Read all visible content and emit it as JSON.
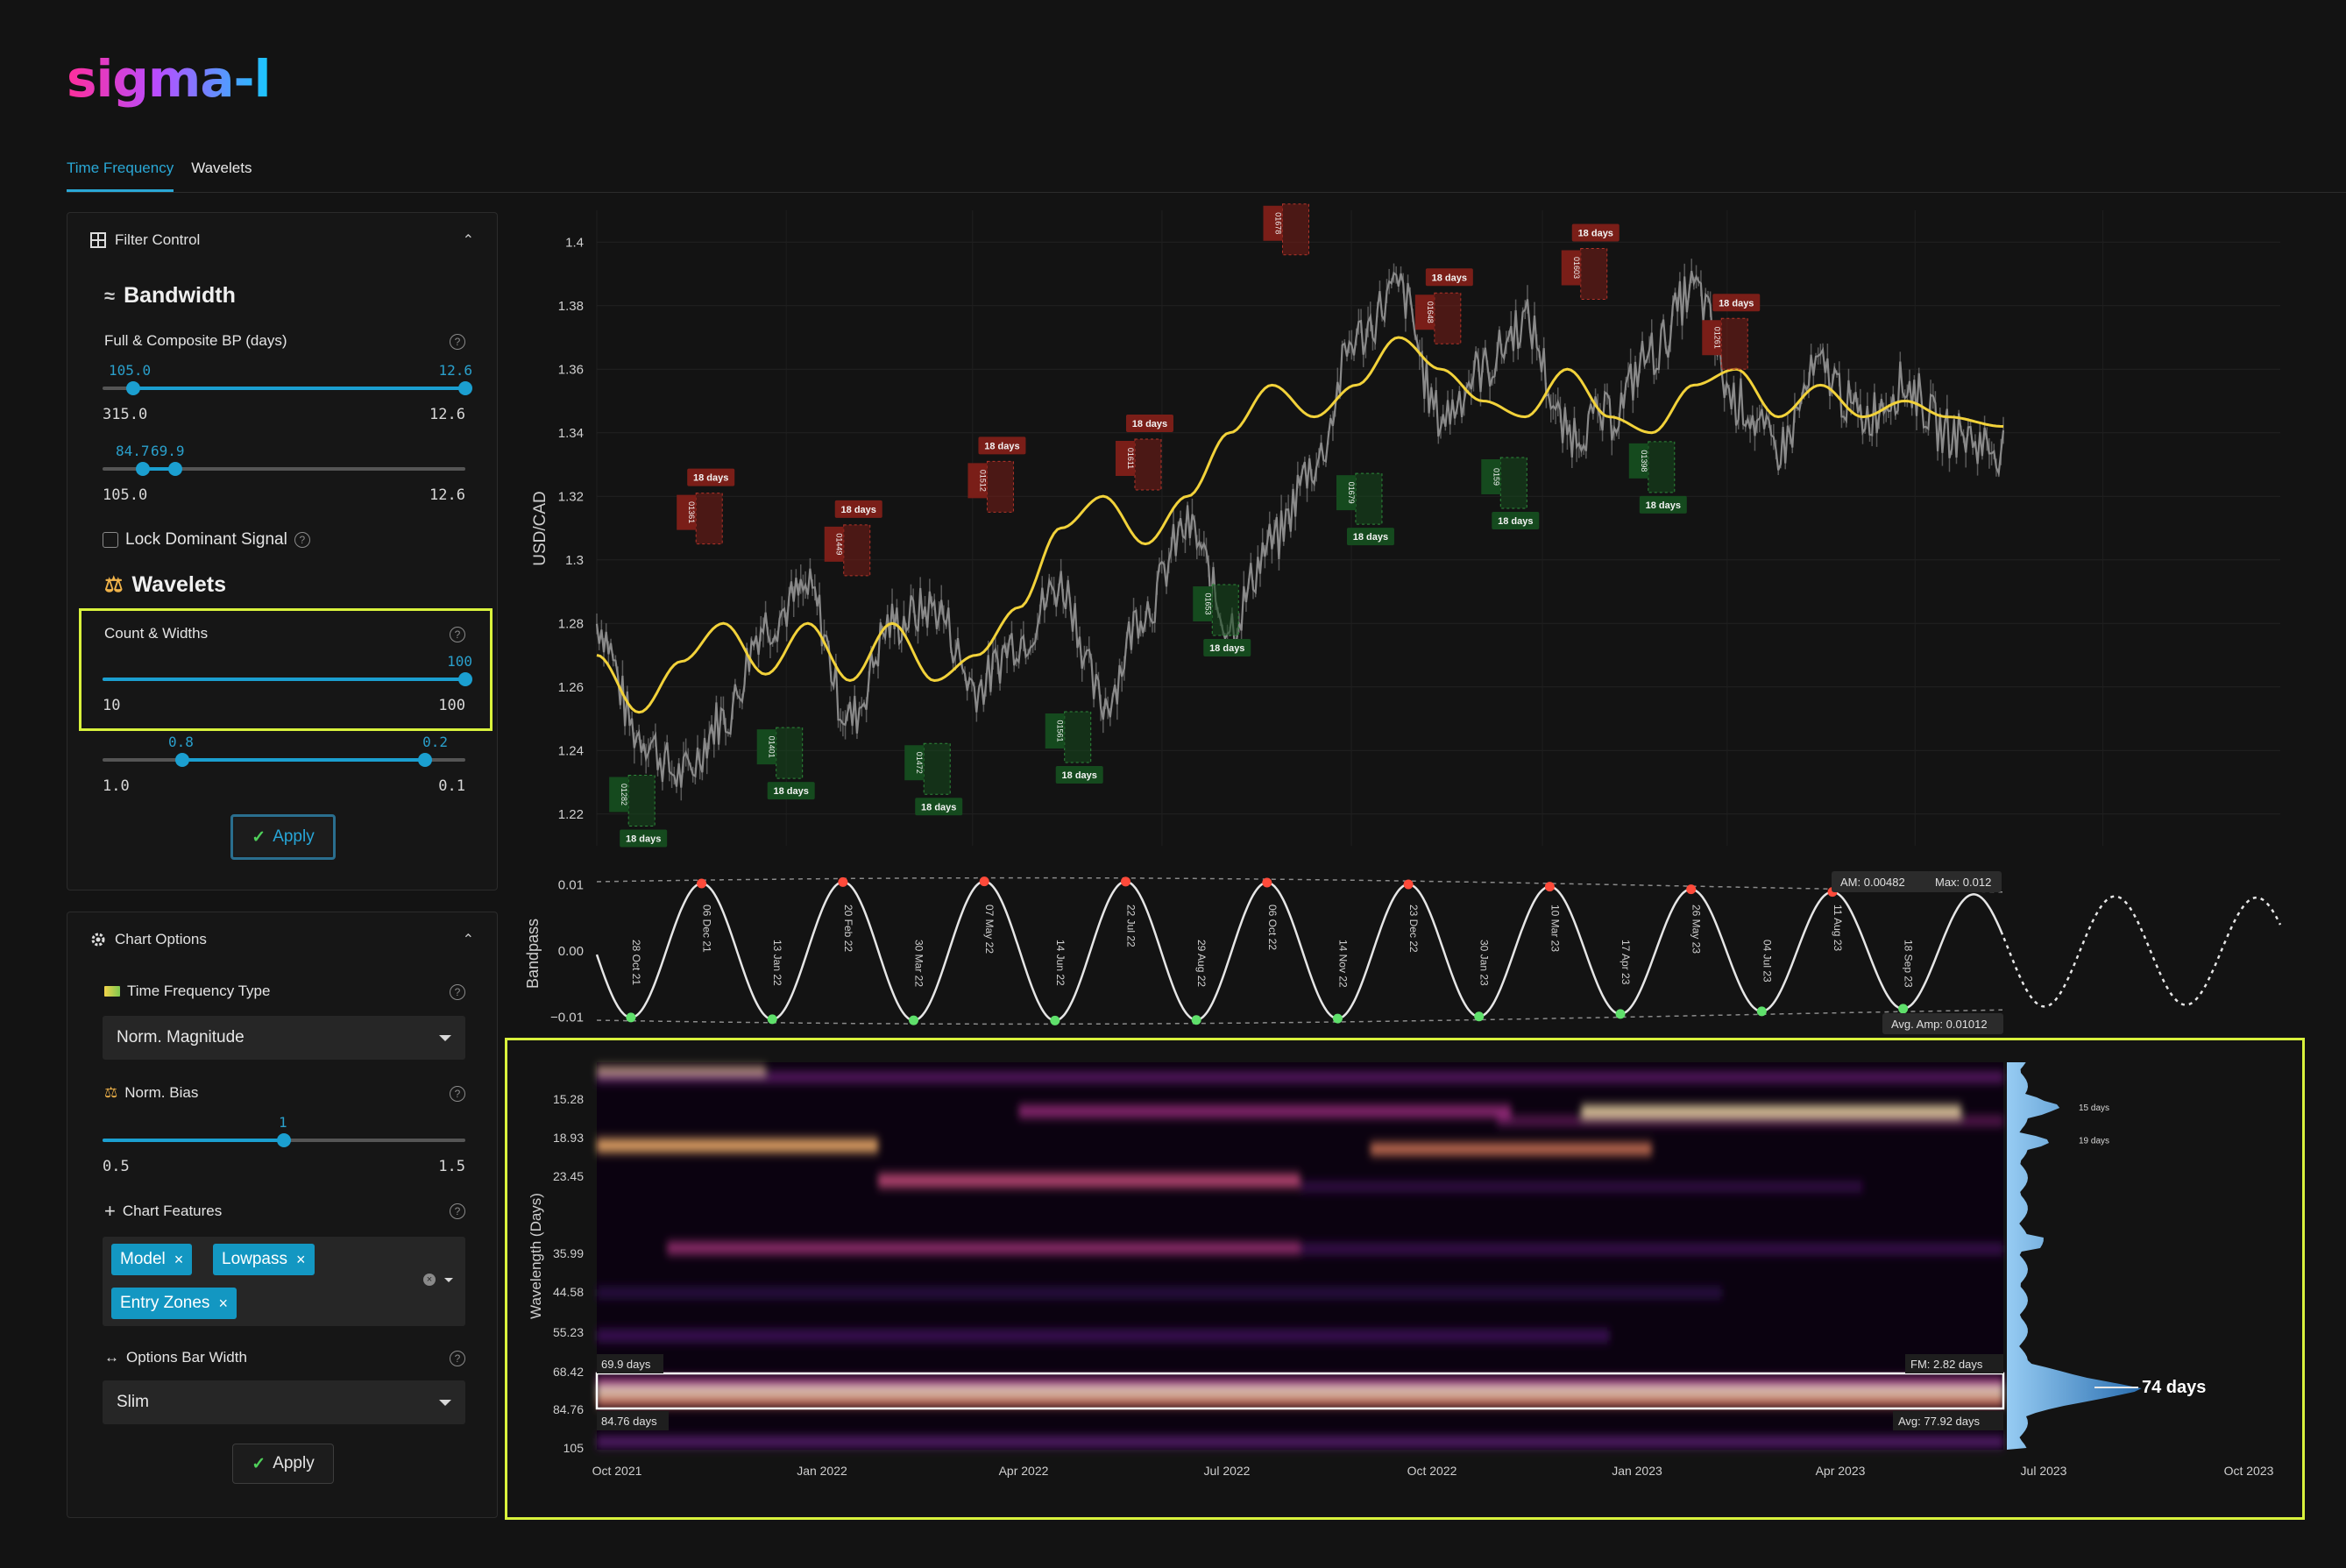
{
  "app": {
    "logo": "sigma-l"
  },
  "tabs": [
    {
      "label": "Time Frequency",
      "active": true
    },
    {
      "label": "Wavelets",
      "active": false
    }
  ],
  "filter_control": {
    "title": "Filter Control",
    "bandwidth": {
      "title": "Bandwidth",
      "full_composite": {
        "label": "Full & Composite BP (days)",
        "low_value": "105.0",
        "high_value": "12.6",
        "min": "315.0",
        "max": "12.6",
        "low_pos": 0.085,
        "high_pos": 1.0
      },
      "second": {
        "low_value": "84.7",
        "high_value": "69.9",
        "min": "105.0",
        "max": "12.6",
        "low_pos": 0.11,
        "high_pos": 0.2
      },
      "lock_label": "Lock Dominant Signal"
    },
    "wavelets": {
      "title": "Wavelets",
      "count_widths": {
        "label": "Count & Widths",
        "value": "100",
        "min": "10",
        "max": "100",
        "pos": 1.0
      },
      "second": {
        "low_value": "0.8",
        "high_value": "0.2",
        "min": "1.0",
        "max": "0.1",
        "low_pos": 0.22,
        "high_pos": 0.89
      }
    },
    "apply_label": "Apply"
  },
  "chart_options": {
    "title": "Chart Options",
    "tf_type": {
      "label": "Time Frequency Type",
      "value": "Norm. Magnitude"
    },
    "norm_bias": {
      "label": "Norm. Bias",
      "value": "1",
      "min": "0.5",
      "max": "1.5",
      "pos": 0.5
    },
    "chart_features": {
      "label": "Chart Features",
      "tags": [
        "Model",
        "Lowpass",
        "Entry Zones"
      ]
    },
    "options_bar_width": {
      "label": "Options Bar Width",
      "value": "Slim"
    },
    "apply_label": "Apply"
  },
  "chart_data": [
    {
      "type": "line",
      "name": "price",
      "ylabel": "USD/CAD",
      "ylim": [
        1.21,
        1.41
      ],
      "yticks": [
        "1.4",
        "1.38",
        "1.36",
        "1.34",
        "1.32",
        "1.3",
        "1.28",
        "1.26",
        "1.24",
        "1.22"
      ],
      "ytick_values": [
        1.4,
        1.38,
        1.36,
        1.34,
        1.32,
        1.3,
        1.28,
        1.26,
        1.24,
        1.22
      ],
      "price_x": [
        0.0,
        0.03,
        0.06,
        0.09,
        0.12,
        0.15,
        0.18,
        0.21,
        0.24,
        0.27,
        0.3,
        0.33,
        0.36,
        0.39,
        0.42,
        0.45,
        0.48,
        0.51,
        0.54,
        0.57,
        0.6,
        0.63,
        0.66,
        0.69,
        0.72,
        0.75,
        0.78,
        0.81,
        0.84,
        0.87,
        0.9,
        0.93,
        0.96,
        1.0
      ],
      "price_y": [
        1.28,
        1.245,
        1.232,
        1.25,
        1.28,
        1.29,
        1.25,
        1.28,
        1.285,
        1.26,
        1.275,
        1.292,
        1.255,
        1.285,
        1.31,
        1.28,
        1.305,
        1.33,
        1.37,
        1.385,
        1.345,
        1.36,
        1.375,
        1.34,
        1.345,
        1.365,
        1.385,
        1.35,
        1.335,
        1.36,
        1.345,
        1.355,
        1.34,
        1.335
      ],
      "lowpass_y": [
        1.27,
        1.252,
        1.268,
        1.28,
        1.264,
        1.28,
        1.262,
        1.28,
        1.262,
        1.27,
        1.285,
        1.31,
        1.32,
        1.305,
        1.32,
        1.34,
        1.355,
        1.345,
        1.355,
        1.37,
        1.36,
        1.35,
        1.345,
        1.36,
        1.345,
        1.34,
        1.355,
        1.36,
        1.345,
        1.355,
        1.345,
        1.35,
        1.345,
        1.342
      ],
      "peaks": [
        {
          "label": "18 days",
          "id": "01361",
          "x": 0.083,
          "y": 1.305
        },
        {
          "label": "18 days",
          "id": "01449",
          "x": 0.188,
          "y": 1.295
        },
        {
          "label": "18 days",
          "id": "01512",
          "x": 0.29,
          "y": 1.315
        },
        {
          "label": "18 days",
          "id": "01611",
          "x": 0.395,
          "y": 1.322
        },
        {
          "label": "18 days",
          "id": "01678",
          "x": 0.5,
          "y": 1.396
        },
        {
          "label": "18 days",
          "id": "01648",
          "x": 0.608,
          "y": 1.368
        },
        {
          "label": "18 days",
          "id": "01603",
          "x": 0.712,
          "y": 1.382
        },
        {
          "label": "18 days",
          "id": "01261",
          "x": 0.812,
          "y": 1.36
        }
      ],
      "troughs": [
        {
          "label": "18 days",
          "id": "01282",
          "x": 0.035,
          "y": 1.23
        },
        {
          "label": "18 days",
          "id": "01401",
          "x": 0.14,
          "y": 1.245
        },
        {
          "label": "18 days",
          "id": "01472",
          "x": 0.245,
          "y": 1.24
        },
        {
          "label": "18 days",
          "id": "01561",
          "x": 0.345,
          "y": 1.25
        },
        {
          "label": "18 days",
          "id": "01653",
          "x": 0.45,
          "y": 1.29
        },
        {
          "label": "18 days",
          "id": "01679",
          "x": 0.552,
          "y": 1.325
        },
        {
          "label": "18 days",
          "id": "0159",
          "x": 0.655,
          "y": 1.33
        },
        {
          "label": "18 days",
          "id": "01398",
          "x": 0.76,
          "y": 1.335
        }
      ]
    },
    {
      "type": "line",
      "name": "bandpass",
      "ylabel": "Bandpass",
      "yticks": [
        "0.01",
        "0.00",
        "−0.01"
      ],
      "ytick_values": [
        0.01,
        0.0,
        -0.01
      ],
      "ylim": [
        -0.0115,
        0.0115
      ],
      "amplitude": 0.0105,
      "period_frac": 0.1005,
      "phase_start_frac": -0.026,
      "projection_start_frac": 0.83,
      "cycle_labels": [
        "28 Oct 21",
        "06 Dec 21",
        "13 Jan 22",
        "20 Feb 22",
        "30 Mar 22",
        "07 May 22",
        "14 Jun 22",
        "22 Jul 22",
        "29 Aug 22",
        "06 Oct 22",
        "14 Nov 22",
        "23 Dec 22",
        "30 Jan 23",
        "10 Mar 23",
        "17 Apr 23",
        "26 May 23",
        "04 Jul 23",
        "11 Aug 23",
        "18 Sep 23"
      ],
      "am_label": "AM: 0.00482",
      "max_label": "Max: 0.012",
      "avg_amp_label": "Avg. Amp: 0.01012"
    },
    {
      "type": "heatmap",
      "name": "wavelet-spectrogram",
      "ylabel": "Wavelength (Days)",
      "yticks": [
        "15.28",
        "18.93",
        "23.45",
        "35.99",
        "44.58",
        "55.23",
        "68.42",
        "84.76",
        "105"
      ],
      "xticks": [
        "Oct 2021",
        "Jan 2022",
        "Apr 2022",
        "Jul 2022",
        "Oct 2022",
        "Jan 2023",
        "Apr 2023",
        "Jul 2023",
        "Oct 2023"
      ],
      "band_low_label": "69.9 days",
      "band_high_label": "84.76 days",
      "fm_label": "FM: 2.82 days",
      "avg_label": "Avg: 77.92 days",
      "dominant_label": "74 days",
      "hist_labels": [
        {
          "label": "15 days",
          "pos": 0.115
        },
        {
          "label": "19 days",
          "pos": 0.2
        }
      ]
    }
  ],
  "colors": {
    "accent": "#1b9fd0",
    "highlight": "#d9f23c",
    "lowpass": "#f2d23a",
    "peak": "#e03b2c",
    "trough": "#3ed35a"
  }
}
